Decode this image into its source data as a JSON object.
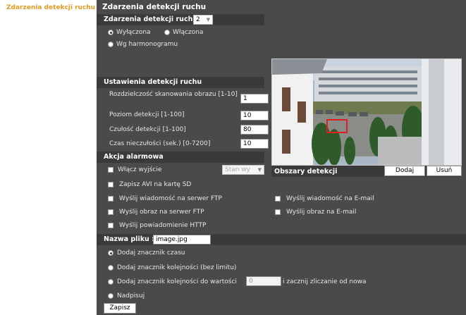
{
  "sidebar": {
    "active_item": "Zdarzenia detekcji ruchu"
  },
  "page": {
    "title": "Zdarzenia detekcji ruchu"
  },
  "event_section": {
    "label": "Zdarzenia detekcji ruchu",
    "select_value": "2",
    "radio_off": "Wyłączona",
    "radio_on": "Włączona",
    "radio_schedule": "Wg harmonogramu",
    "selected": "Wyłączona"
  },
  "settings": {
    "label": "Ustawienia detekcji ruchu",
    "resolution_label": "Rozdzielczość skanowania obrazu [1-10]",
    "resolution_value": "1",
    "level_label": "Poziom detekcji [1-100]",
    "level_value": "10",
    "sensitivity_label": "Czułość detekcji [1-100]",
    "sensitivity_value": "80",
    "idle_label": "Czas nieczułości (sek.) [0-7200]",
    "idle_value": "10"
  },
  "alarm": {
    "label": "Akcja alarmowa",
    "output_label": "Włącz wyjście",
    "output_state": "Stan wy",
    "save_avi": "Zapisz AVI na kartę SD",
    "ftp_msg": "Wyślij wiadomość na serwer FTP",
    "ftp_img": "Wyślij obraz na serwer FTP",
    "http_notify": "Wyślij powiadomienie HTTP",
    "email_msg": "Wyślij wiadomość na E-mail",
    "email_img": "Wyślij obraz na E-mail"
  },
  "detection_areas": {
    "label": "Obszary detekcji",
    "add": "Dodaj",
    "remove": "Usuń"
  },
  "filename": {
    "label": "Nazwa pliku :",
    "value": "image.jpg",
    "opt_timestamp": "Dodaj znacznik czasu",
    "opt_sequence": "Dodaj znacznik kolejności (bez limitu)",
    "opt_sequence_to": "Dodaj znacznik kolejności do wartości",
    "sequence_to_value": "0",
    "sequence_to_suffix": "i zacznij zliczanie od nowa",
    "opt_overwrite": "Nadpisuj",
    "selected": "Dodaj znacznik czasu"
  },
  "save_button": "Zapisz",
  "colors": {
    "accent": "#e39a22",
    "panel": "#4a4a4a",
    "section": "#3a3a3a",
    "detection_box": "#e02020"
  }
}
